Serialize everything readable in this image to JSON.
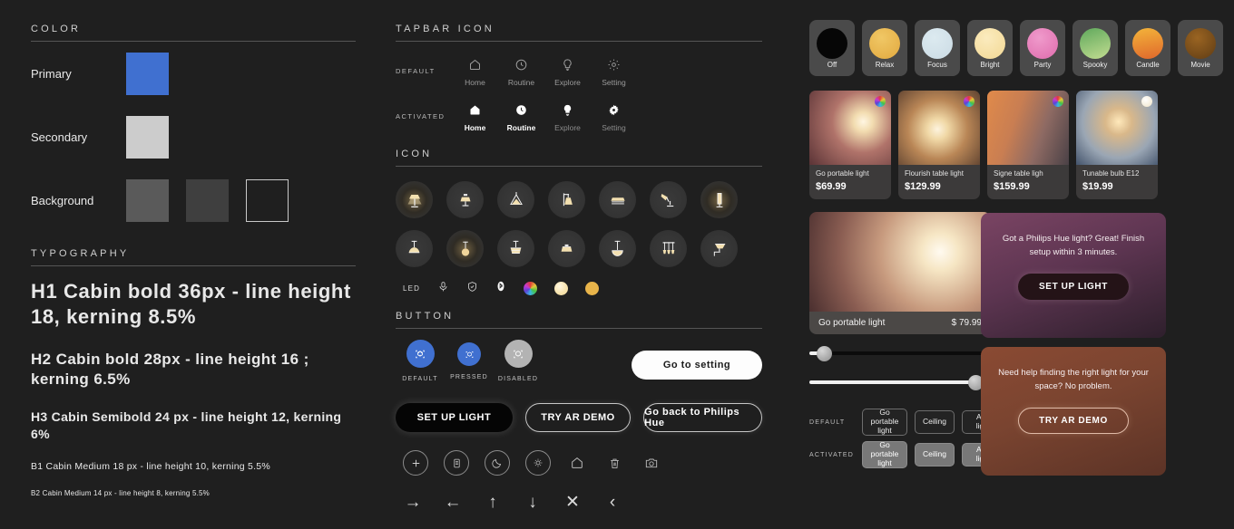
{
  "color": {
    "heading": "COLOR",
    "rows": [
      {
        "label": "Primary",
        "swatches": [
          "#4070d0"
        ]
      },
      {
        "label": "Secondary",
        "swatches": [
          "#cccccc"
        ]
      },
      {
        "label": "Background",
        "swatches": [
          "#5a5a5a",
          "#3f3f3f",
          "outline"
        ]
      }
    ]
  },
  "typography": {
    "heading": "TYPOGRAPHY",
    "h1": "H1 Cabin bold 36px - line height 18, kerning 8.5%",
    "h2": "H2 Cabin bold 28px - line height 16 ; kerning 6.5%",
    "h3": "H3 Cabin Semibold 24 px - line height 12, kerning 6%",
    "b1": "B1 Cabin Medium 18 px - line height 10, kerning 5.5%",
    "b2": "B2 Cabin Medium 14 px - line height 8, kerning 5.5%"
  },
  "tapbar": {
    "heading": "TAPBAR ICON",
    "default_label": "DEFAULT",
    "activated_label": "ACTIVATED",
    "items": [
      {
        "label": "Home",
        "icon": "home-icon"
      },
      {
        "label": "Routine",
        "icon": "clock-icon"
      },
      {
        "label": "Explore",
        "icon": "bulb-icon"
      },
      {
        "label": "Setting",
        "icon": "gear-icon"
      }
    ]
  },
  "icons": {
    "heading": "ICON",
    "row1": [
      "table-lamp-icon",
      "shade-lamp-icon",
      "cone-pendant-icon",
      "wall-sconce-icon",
      "flat-panel-icon",
      "desk-lamp-icon",
      "floor-tube-icon"
    ],
    "row2": [
      "dome-pendant-icon",
      "globe-pendant-icon",
      "drum-pendant-icon",
      "bowl-ceiling-icon",
      "half-dome-icon",
      "triple-pendant-icon",
      "angled-sconce-icon"
    ],
    "chips": {
      "led_label": "LED",
      "items": [
        "mic-icon",
        "shield-check-icon",
        "bluetooth-icon",
        "rgb-color-dot",
        "warm-white-dot",
        "amber-dot"
      ]
    }
  },
  "button": {
    "heading": "BUTTON",
    "ar_states": [
      {
        "label": "DEFAULT",
        "icon": "ar-cube-icon"
      },
      {
        "label": "PRESSED",
        "icon": "ar-cube-icon"
      },
      {
        "label": "DISABLED",
        "icon": "ar-cube-icon"
      }
    ],
    "go_to_setting": "Go to setting",
    "set_up_light": "SET UP LIGHT",
    "try_ar_demo": "TRY AR DEMO",
    "go_back": "Go back to Philips Hue",
    "tools": [
      "plus-icon",
      "list-icon",
      "moon-icon",
      "brightness-icon",
      "home-icon",
      "trash-icon",
      "camera-icon"
    ],
    "arrows": [
      "→",
      "←",
      "↑",
      "↓",
      "✕",
      "‹"
    ]
  },
  "scenes": [
    {
      "label": "Off",
      "color": "#060606",
      "color2": "#000000"
    },
    {
      "label": "Relax",
      "color": "#eec05a",
      "color2": "#e2a93f"
    },
    {
      "label": "Focus",
      "color": "#d6e4ea",
      "color2": "#cbdbe4"
    },
    {
      "label": "Bright",
      "color": "#f8e4ae",
      "color2": "#f2d894"
    },
    {
      "label": "Party",
      "color": "#e985bd",
      "color2": "#e06fb0"
    },
    {
      "label": "Spooky",
      "color": "#6fb06a",
      "color2": "#b8d98a"
    },
    {
      "label": "Candle",
      "color": "#f0a935",
      "color2": "#e2722f"
    },
    {
      "label": "Movie",
      "color": "#8a5a1e",
      "color2": "#6b441a"
    }
  ],
  "products": [
    {
      "name": "Go portable light",
      "price": "$69.99",
      "badge": "rgb"
    },
    {
      "name": "Flourish table light",
      "price": "$129.99",
      "badge": "rgb"
    },
    {
      "name": "Signe table ligh",
      "price": "$159.99",
      "badge": "rgb"
    },
    {
      "name": "Tunable bulb E12",
      "price": "$19.99",
      "badge": "white"
    }
  ],
  "hero": {
    "name": "Go portable light",
    "price": "$ 79.99"
  },
  "sliders": [
    {
      "name": "brightness-slider-low",
      "value": 4,
      "style": "dark"
    },
    {
      "name": "brightness-slider-high",
      "value": 96,
      "style": "light"
    }
  ],
  "chips": {
    "default_label": "DEFAULT",
    "activated_label": "ACTIVATED",
    "items": [
      "Go portable light",
      "Ceiling",
      "Add light"
    ]
  },
  "promos": [
    {
      "text": "Got a Philips Hue light? Great! Finish setup within 3 minutes.",
      "button": "SET UP LIGHT",
      "style": "purple"
    },
    {
      "text": "Need help finding the right light for your space? No problem.",
      "button": "TRY AR DEMO",
      "style": "brown"
    }
  ]
}
